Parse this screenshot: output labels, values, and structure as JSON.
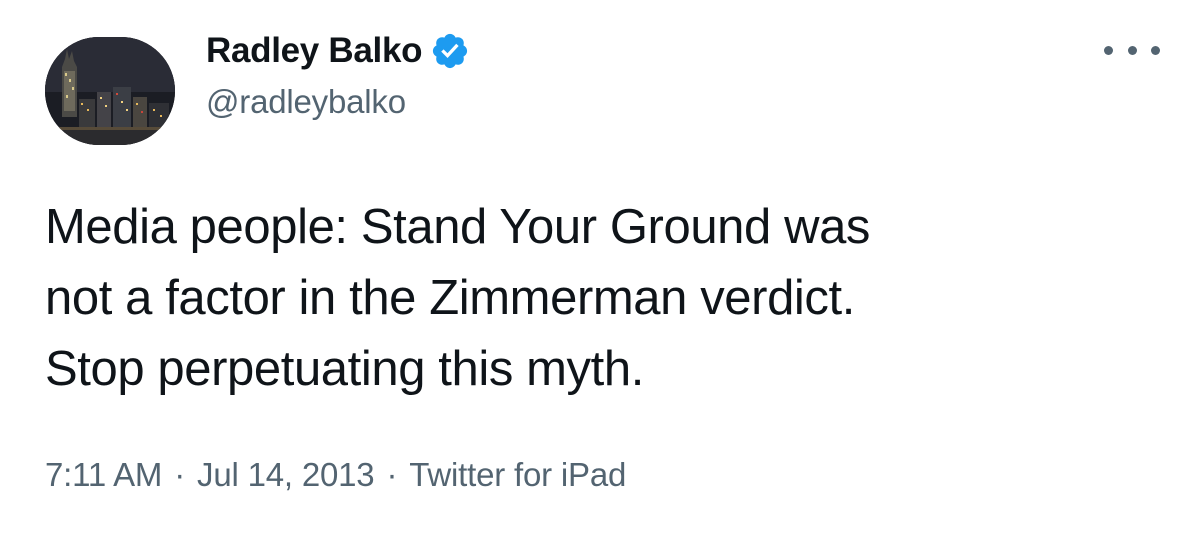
{
  "author": {
    "display_name": "Radley Balko",
    "handle": "@radleybalko",
    "verified": true,
    "avatar_icon": "nashville-skyline-night-avatar"
  },
  "tweet": {
    "text": "Media people: Stand Your Ground was\nnot a factor in the Zimmerman verdict.\nStop perpetuating this myth.",
    "time": "7:11 AM",
    "date": "Jul 14, 2013",
    "source": "Twitter for iPad",
    "separator": "·"
  },
  "icons": {
    "verified": "verified-badge-icon",
    "more": "more-options-icon"
  },
  "colors": {
    "verified_blue": "#1d9bf0",
    "text_primary": "#0f1419",
    "text_secondary": "#536471"
  }
}
